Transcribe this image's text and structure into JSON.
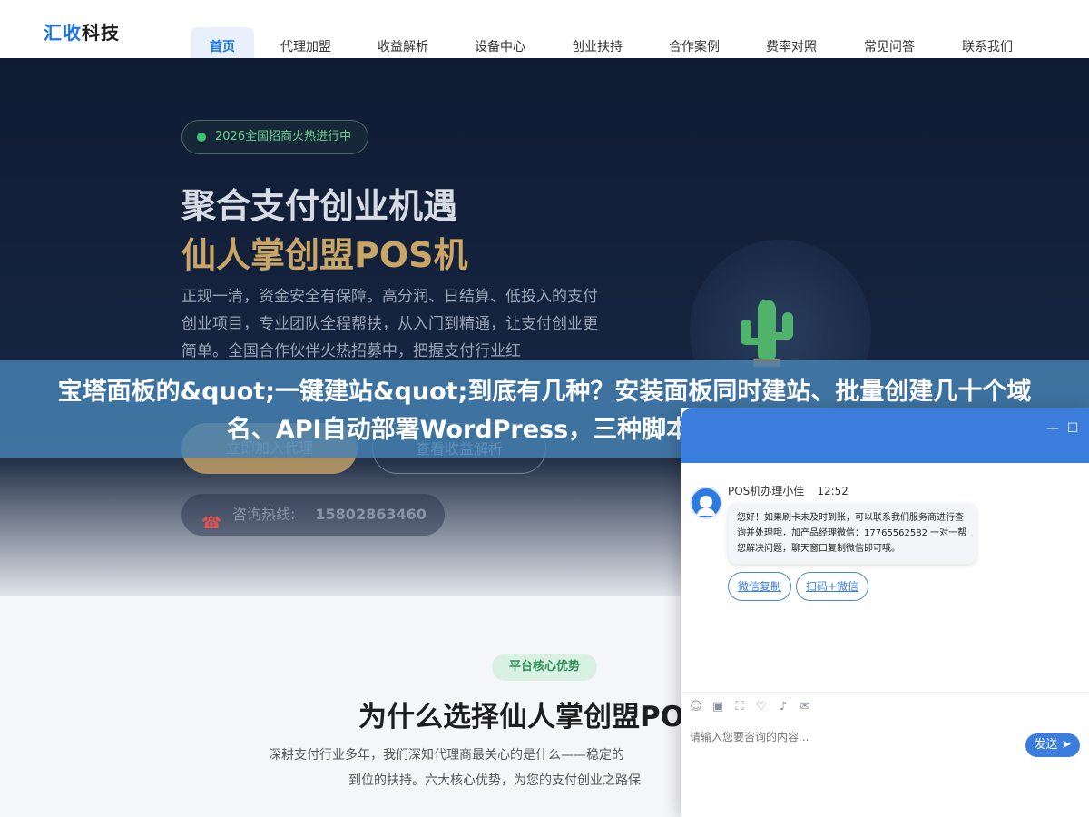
{
  "header": {
    "logo_accent": "汇收",
    "logo_rest": "科技",
    "nav": [
      {
        "label": "首页",
        "active": true
      },
      {
        "label": "代理加盟"
      },
      {
        "label": "收益解析"
      },
      {
        "label": "设备中心"
      },
      {
        "label": "创业扶持"
      },
      {
        "label": "合作案例"
      },
      {
        "label": "费率对照"
      },
      {
        "label": "常见问答"
      },
      {
        "label": "联系我们"
      }
    ]
  },
  "hero": {
    "badge": "2026全国招商火热进行中",
    "title_line1": "聚合支付创业机遇",
    "title_line2": "仙人掌创盟POS机",
    "description": "正规一清，资金安全有保障。高分润、日结算、低投入的支付创业项目，专业团队全程帮扶，从入门到精通，让支付创业更简单。全国合作伙伴火热招募中，把握支付行业红",
    "primary_button": "立即加入代理",
    "secondary_button": "查看收益解析",
    "hotline_label": "咨询热线:",
    "hotline_number": "15802863460"
  },
  "overlay_title": "宝塔面板的&quot;一键建站&quot;到底有几种？安装面板同时建站、批量创建几十个域名、API自动部署WordPress，三种脚本全给你，比挨个",
  "section": {
    "tag": "平台核心优势",
    "title": "为什么选择仙人掌创盟POS",
    "desc_line1": "深耕支付行业多年，我们深知代理商最关心的是什么——稳定的",
    "desc_line2": "到位的扶持。六大核心优势，为您的支付创业之路保"
  },
  "chat": {
    "sender": "POS机办理小佳",
    "time": "12:52",
    "message": "您好！如果刷卡未及时到账，可以联系我们服务商进行查询并处理哦，加产品经理微信：17765562582 一对一帮您解决问题，聊天窗口复制微信即可哦。",
    "quick_replies": [
      "微信复制",
      "扫码+微信"
    ],
    "input_placeholder": "请输入您要咨询的内容...",
    "send_label": "发送",
    "header_color": "#3b7ddd"
  },
  "colors": {
    "brand": "#1a73e8",
    "gold": "#c9a566",
    "banner": "#4682b4"
  }
}
